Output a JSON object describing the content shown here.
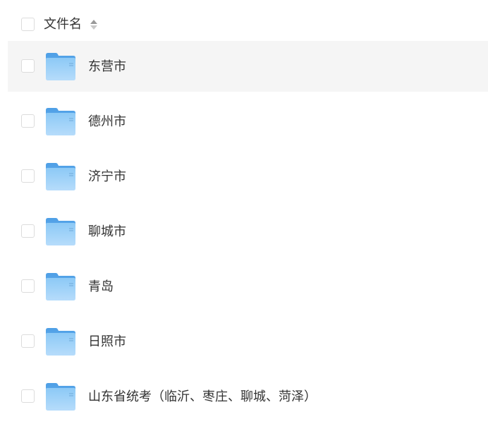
{
  "header": {
    "column_label": "文件名",
    "sort_icon": "sort-icon"
  },
  "rows": [
    {
      "name": "东营市",
      "icon": "folder-icon"
    },
    {
      "name": "德州市",
      "icon": "folder-icon"
    },
    {
      "name": "济宁市",
      "icon": "folder-icon"
    },
    {
      "name": "聊城市",
      "icon": "folder-icon"
    },
    {
      "name": "青岛",
      "icon": "folder-icon"
    },
    {
      "name": "日照市",
      "icon": "folder-icon"
    },
    {
      "name": "山东省统考（临沂、枣庄、聊城、菏泽）",
      "icon": "folder-icon"
    }
  ],
  "colors": {
    "hover_row": "#f5f5f5",
    "text": "#333333",
    "checkbox_border": "#dcdcdc",
    "folder_blue": "#5aa9ea"
  }
}
